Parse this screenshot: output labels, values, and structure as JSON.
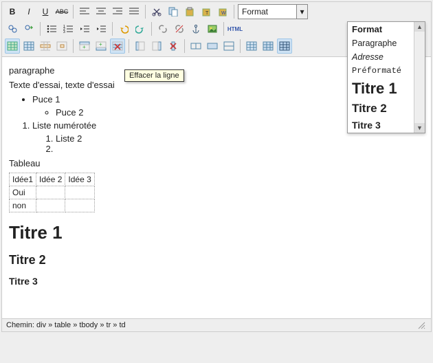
{
  "format_select": {
    "label": "Format"
  },
  "dropdown": {
    "items": [
      {
        "text": "Format",
        "cls": "dd-header"
      },
      {
        "text": "Paragraphe",
        "cls": "dd-para"
      },
      {
        "text": "Adresse",
        "cls": "dd-adresse"
      },
      {
        "text": "Préformaté",
        "cls": "dd-pre"
      },
      {
        "text": "Titre 1",
        "cls": "dd-t1"
      },
      {
        "text": "Titre 2",
        "cls": "dd-t2"
      },
      {
        "text": "Titre 3",
        "cls": "dd-t3"
      }
    ]
  },
  "tooltip": "Effacer la ligne",
  "content": {
    "paragraph_label": "paragraphe",
    "sample_text": "Texte d'essai, texte d'essai",
    "bullet1": "Puce 1",
    "bullet2": "Puce 2",
    "numbered1": "Liste numérotée",
    "numbered1_1": "Liste 2",
    "numbered1_2": "",
    "table_label": "Tableau",
    "table": {
      "r1": [
        "Idée1",
        "Idée 2",
        "Idée 3"
      ],
      "r2": [
        "Oui",
        "",
        ""
      ],
      "r3": [
        "non",
        "",
        ""
      ]
    },
    "h1": "Titre 1",
    "h2": "Titre 2",
    "h3": "Titre 3"
  },
  "status": {
    "path": "Chemin: div » table » tbody » tr » td"
  }
}
